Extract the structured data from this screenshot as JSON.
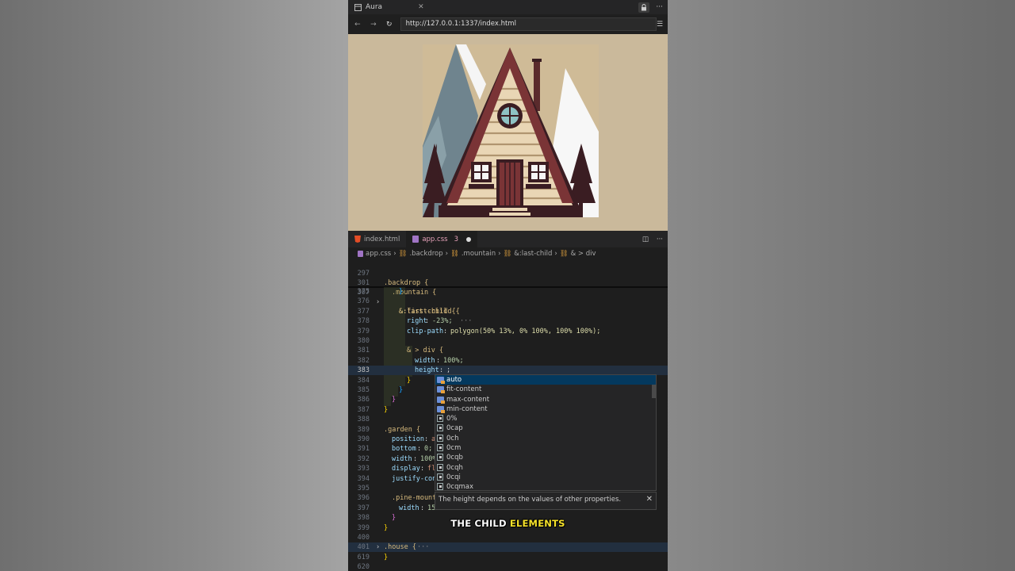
{
  "titlebar": {
    "tab_label": "Aura",
    "close": "✕",
    "more": "···"
  },
  "browser": {
    "url": "http://127.0.0.1:1337/index.html"
  },
  "editor_tabs": [
    {
      "label": "index.html"
    },
    {
      "label": "app.css",
      "badge": "3"
    }
  ],
  "breadcrumb": [
    "app.css",
    ".backdrop",
    ".mountain",
    "&:last-child",
    "& > div"
  ],
  "sticky": [
    {
      "ln": "297",
      "text": ".backdrop {"
    },
    {
      "ln": "301",
      "text": ".mountain {"
    },
    {
      "ln": "307",
      "text": "&:first-child {",
      "collapsed": "···"
    }
  ],
  "lines": [
    {
      "ln": "375",
      "text": "}"
    },
    {
      "ln": "376",
      "text": ""
    },
    {
      "ln": "377",
      "text": "&:last-child {"
    },
    {
      "ln": "378",
      "prop": "right",
      "value": "-23%;"
    },
    {
      "ln": "379",
      "prop": "clip-path",
      "value": "polygon(50% 13%, 0% 100%, 100% 100%);"
    },
    {
      "ln": "380",
      "text": ""
    },
    {
      "ln": "381",
      "text": "& > div {"
    },
    {
      "ln": "382",
      "prop": "width",
      "value": "100%;"
    },
    {
      "ln": "383",
      "prop": "height",
      "value": ";"
    },
    {
      "ln": "384",
      "text": "}"
    },
    {
      "ln": "385",
      "text": "}"
    },
    {
      "ln": "386",
      "text": "}"
    },
    {
      "ln": "387",
      "text": "}"
    },
    {
      "ln": "388",
      "text": ""
    },
    {
      "ln": "389",
      "text": ".garden {"
    },
    {
      "ln": "390",
      "prop": "position",
      "value": "a"
    },
    {
      "ln": "391",
      "prop": "bottom",
      "value": "0;"
    },
    {
      "ln": "392",
      "prop": "width",
      "value": "100%"
    },
    {
      "ln": "393",
      "prop": "display",
      "value": "fl"
    },
    {
      "ln": "394",
      "prop": "justify-con",
      "value": ""
    },
    {
      "ln": "395",
      "text": ""
    },
    {
      "ln": "396",
      "text": ".pine-mount"
    },
    {
      "ln": "397",
      "prop": "width",
      "value": "15"
    },
    {
      "ln": "398",
      "text": "}"
    },
    {
      "ln": "399",
      "text": "}"
    },
    {
      "ln": "400",
      "text": ""
    },
    {
      "ln": "401",
      "text": ".house {",
      "collapsed": "···"
    },
    {
      "ln": "619",
      "text": "}"
    },
    {
      "ln": "620",
      "text": ""
    }
  ],
  "suggestions": [
    "auto",
    "fit-content",
    "max-content",
    "min-content",
    "0%",
    "0cap",
    "0ch",
    "0cm",
    "0cqb",
    "0cqh",
    "0cqi",
    "0cqmax"
  ],
  "suggestion_detail": "The height depends on the values of other properties.",
  "caption": {
    "part1": "THE CHILD ",
    "part2": "ELEMENTS"
  }
}
